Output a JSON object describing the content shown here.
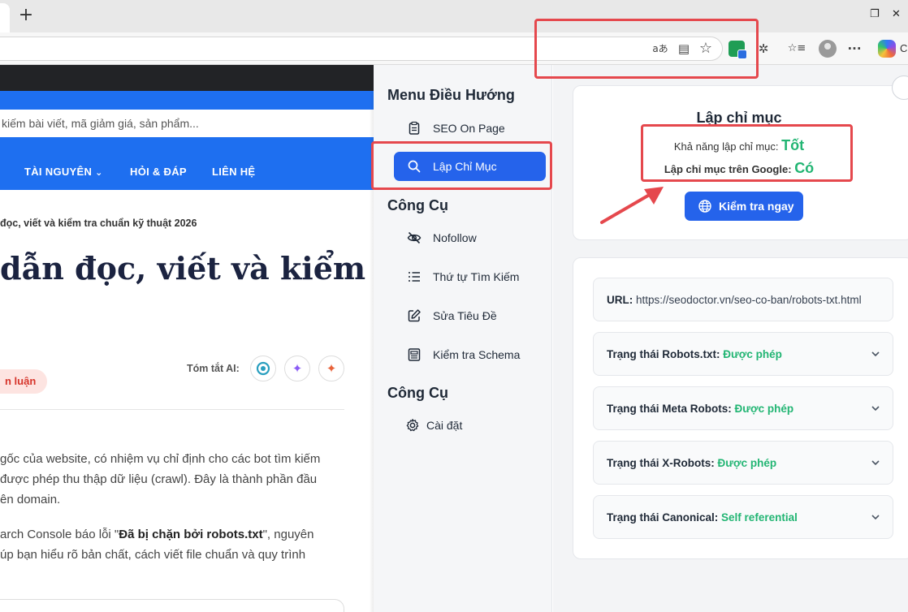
{
  "browser": {
    "new_tab_glyph": "+",
    "restore_glyph": "❐",
    "close_glyph": "✕",
    "icons": [
      "read-aloud-icon",
      "reader-view-icon",
      "favorite-star-icon",
      "extension-icon",
      "puzzle-icon",
      "favorites-icon",
      "profile-icon",
      "more-icon",
      "copilot-icon"
    ],
    "read_aloud_glyph": "aあ",
    "reader_glyph": "▤",
    "star_glyph": "☆",
    "puzzle_glyph": "✲",
    "favorites_glyph": "☆≡",
    "more_glyph": "···",
    "copilot_label": "C"
  },
  "site": {
    "search_placeholder": "kiếm bài viết, mã giảm giá, sản phẩm...",
    "nav": [
      "TÀI NGUYÊN",
      "HỎI & ĐÁP",
      "LIÊN HỆ"
    ],
    "nav_chevron": "⌄",
    "breadcrumb": "đọc, viết và kiểm tra chuẩn kỹ thuật 2026",
    "headline": "dẫn đọc, viết và kiểm",
    "ai_summary_label": "Tóm tắt AI:",
    "tag": "n luận",
    "para1": [
      "gốc của website, có nhiệm vụ chỉ định cho các bot tìm kiếm",
      "được phép thu thập dữ liệu (crawl). Đây là thành phần đầu",
      "ên domain."
    ],
    "para2_line1_prefix": "arch Console báo lỗi \"",
    "para2_line1_bold": "Đã bị chặn bởi robots.txt",
    "para2_line1_suffix": "\", nguyên",
    "para2_line2": "úp bạn hiểu rõ bản chất, cách viết file chuẩn và quy trình",
    "para2_line3": ""
  },
  "menu": {
    "heading": "Menu Điều Hướng",
    "items": [
      "SEO On Page",
      "Lập Chỉ Mục"
    ],
    "tools_heading": "Công Cụ",
    "tools": [
      "Nofollow",
      "Thứ tự Tìm Kiếm",
      "Sửa Tiêu Đề",
      "Kiểm tra Schema"
    ],
    "tools_heading_2": "Công Cụ",
    "settings": [
      "Cài đặt"
    ]
  },
  "index_card": {
    "title": "Lập chỉ mục",
    "indexability_label": "Khả năng lập chỉ mục:",
    "indexability_value": "Tốt",
    "google_label": "Lập chỉ mục trên Google:",
    "google_value": "Có",
    "check_button": "Kiểm tra ngay"
  },
  "details": {
    "url_label": "URL:",
    "url_value": "https://seodoctor.vn/seo-co-ban/robots-txt.html",
    "rows": [
      {
        "label": "Trạng thái Robots.txt:",
        "value": "Được phép"
      },
      {
        "label": "Trạng thái Meta Robots:",
        "value": "Được phép"
      },
      {
        "label": "Trạng thái X-Robots:",
        "value": "Được phép"
      },
      {
        "label": "Trạng thái Canonical:",
        "value": "Self referential"
      }
    ]
  },
  "colors": {
    "accent": "#2563eb",
    "success": "#22b573",
    "highlight": "#e5484d"
  }
}
